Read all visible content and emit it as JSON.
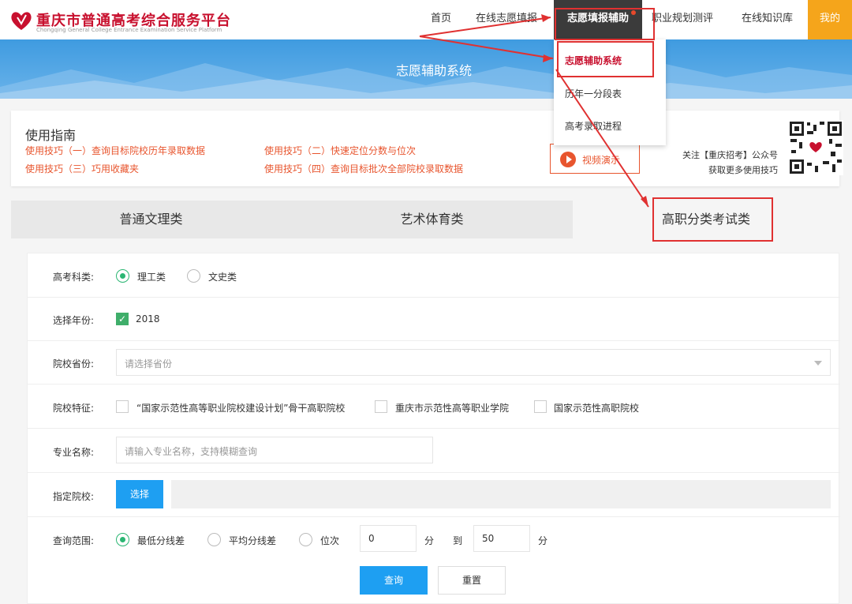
{
  "header": {
    "logo_title": "重庆市普通高考综合服务平台",
    "logo_subtitle": "Chongqing General College Entrance Examination Service Platform",
    "nav": [
      {
        "label": "首页"
      },
      {
        "label": "在线志愿填报"
      },
      {
        "label": "志愿填报辅助"
      },
      {
        "label": "职业规划测评"
      },
      {
        "label": "在线知识库"
      },
      {
        "label": "我的"
      }
    ]
  },
  "banner": {
    "title": "志愿辅助系统"
  },
  "dropdown": {
    "items": [
      {
        "label": "志愿辅助系统"
      },
      {
        "label": "历年一分段表"
      },
      {
        "label": "高考录取进程"
      }
    ]
  },
  "guide": {
    "title": "使用指南",
    "tips": [
      {
        "label": "使用技巧（一）查询目标院校历年录取数据"
      },
      {
        "label": "使用技巧（二）快速定位分数与位次"
      },
      {
        "label": "使用技巧（三）巧用收藏夹"
      },
      {
        "label": "使用技巧（四）查询目标批次全部院校录取数据"
      }
    ],
    "video_button": "视频演示",
    "qr_line1": "关注【重庆招考】公众号",
    "qr_line2": "获取更多使用技巧"
  },
  "tabs": [
    {
      "label": "普通文理类"
    },
    {
      "label": "艺术体育类"
    },
    {
      "label": "高职分类考试类"
    }
  ],
  "form": {
    "subject": {
      "label": "高考科类:",
      "options": [
        {
          "label": "理工类",
          "checked": true
        },
        {
          "label": "文史类",
          "checked": false
        }
      ]
    },
    "year": {
      "label": "选择年份:",
      "value": "2018",
      "checked": true
    },
    "province": {
      "label": "院校省份:",
      "placeholder": "请选择省份"
    },
    "features": {
      "label": "院校特征:",
      "options": [
        {
          "label": "“国家示范性高等职业院校建设计划”骨干高职院校"
        },
        {
          "label": "重庆市示范性高等职业学院"
        },
        {
          "label": "国家示范性高职院校"
        }
      ]
    },
    "major": {
      "label": "专业名称:",
      "placeholder": "请输入专业名称，支持模糊查询"
    },
    "school": {
      "label": "指定院校:",
      "button": "选择"
    },
    "range": {
      "label": "查询范围:",
      "options": [
        {
          "label": "最低分线差",
          "checked": true
        },
        {
          "label": "平均分线差",
          "checked": false
        },
        {
          "label": "位次",
          "checked": false
        }
      ],
      "from": "0",
      "to": "50",
      "unit": "分",
      "to_label": "到"
    },
    "submit": "查询",
    "reset": "重置"
  },
  "colors": {
    "accent": "#e8552e",
    "nav_active_bg": "#3b3b3b",
    "annotation": "#e03131",
    "primary": "#1e9ff2"
  },
  "icons": {
    "logo": "heart-logo-icon",
    "video": "play-icon",
    "qr": "qr-code-icon"
  }
}
